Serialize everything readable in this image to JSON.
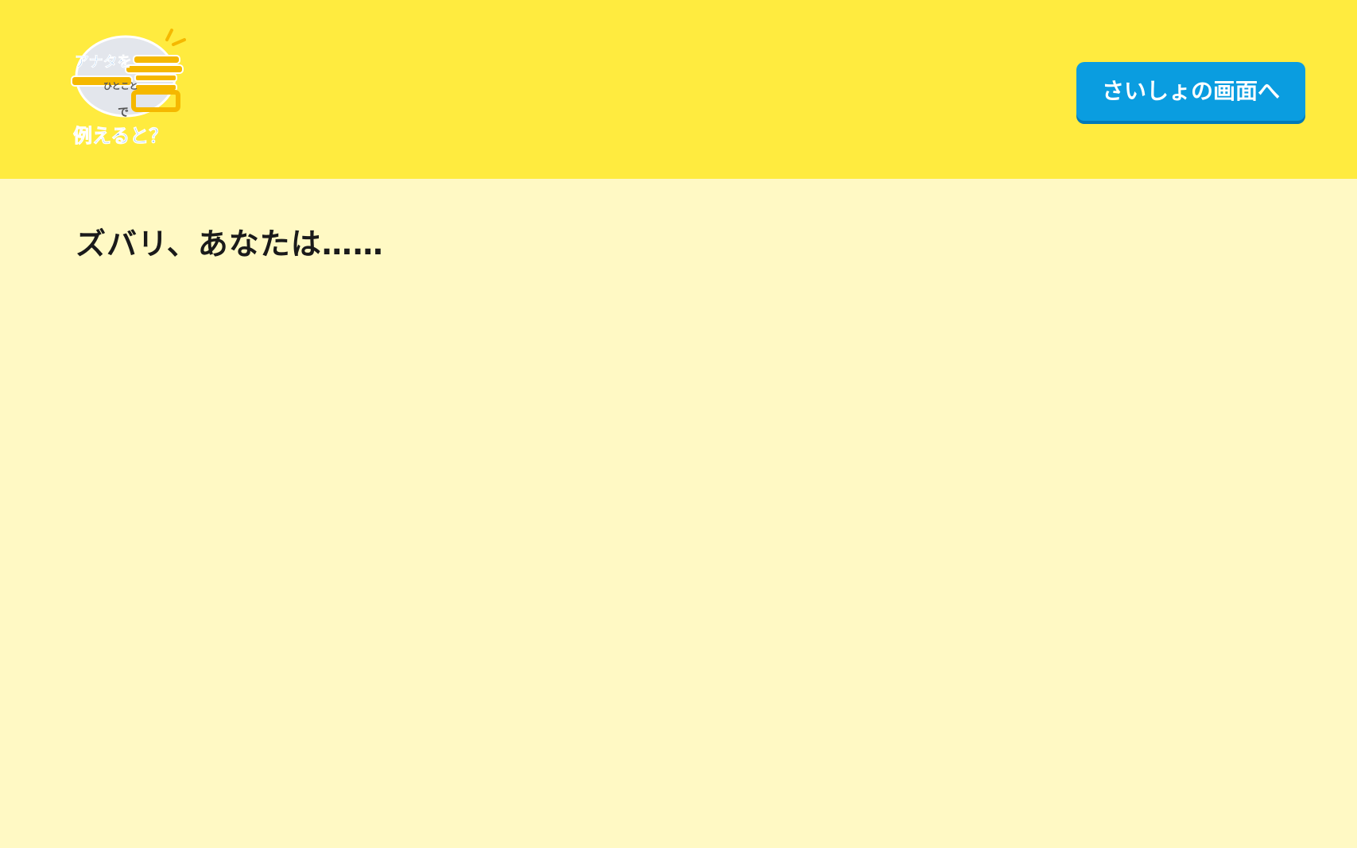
{
  "logo": {
    "line1": "アナタを",
    "big_char": "言",
    "line2": "ひとこと",
    "line3": "で",
    "line4": "例えると？"
  },
  "header": {
    "home_button_label": "さいしょの画面へ"
  },
  "main": {
    "result_heading": "ズバリ、あなたは……"
  },
  "colors": {
    "header_background": "#FFEB3F",
    "page_background": "#FFF9C4",
    "button_background": "#0A9DE0",
    "logo_blue": "#2E86DE",
    "logo_orange": "#F5B800"
  }
}
